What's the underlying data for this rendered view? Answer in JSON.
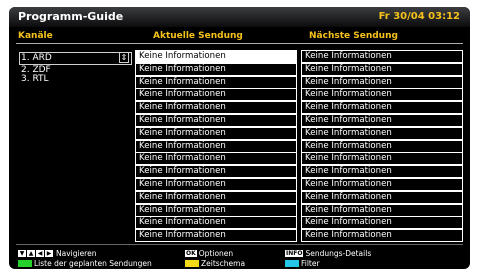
{
  "header": {
    "title": "Programm-Guide",
    "datetime": "Fr 30/04 03:12"
  },
  "columns": {
    "channels": "Kanäle",
    "current": "Aktuelle Sendung",
    "next": "Nächste Sendung"
  },
  "channels": [
    "1. ARD",
    "2. ZDF",
    "3. RTL"
  ],
  "no_info": "Keine Informationen",
  "footer": {
    "navigate": "Navigieren",
    "options_key": "OK",
    "options": "Optionen",
    "info_key": "INFO",
    "details": "Sendungs-Details",
    "scheduled": "Liste der geplanten Sendungen",
    "timeline": "Zeitschema",
    "filter": "Filter"
  },
  "colors": {
    "accent": "#f5c21b",
    "green": "#26d12b",
    "yellow": "#f4d91a",
    "cyan": "#25c6e8"
  }
}
